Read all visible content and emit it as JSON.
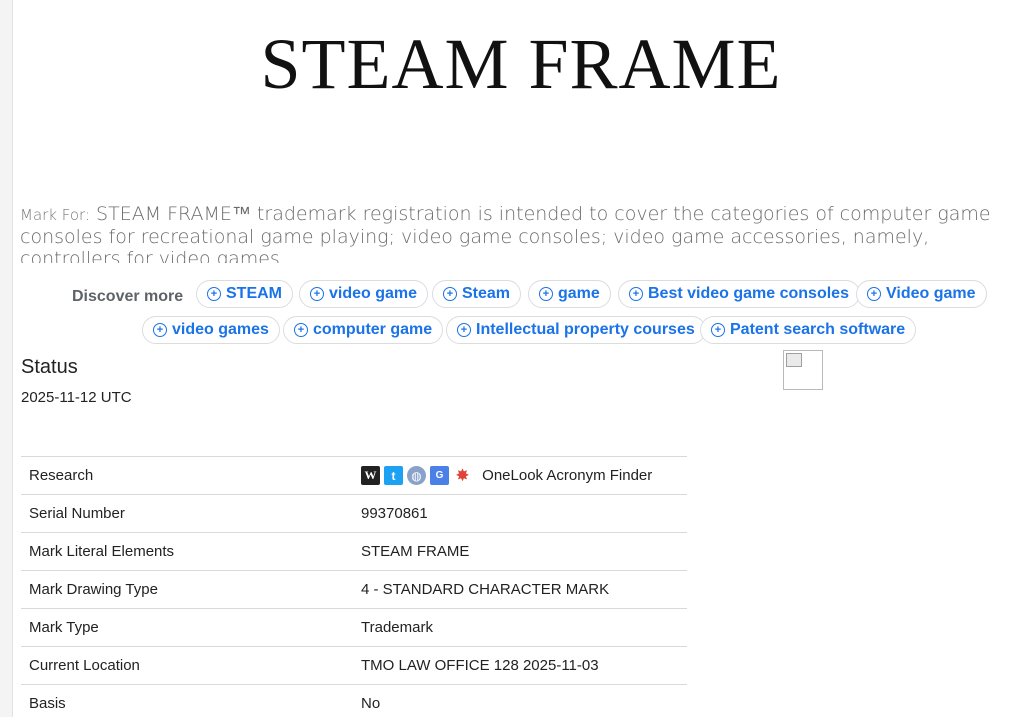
{
  "mark": {
    "title": "STEAM FRAME",
    "mark_for_label": "Mark For:",
    "mark_for_text": "STEAM FRAME™ trademark registration is intended to cover the categories of computer game consoles for recreational game playing; video game consoles; video game accessories, namely, controllers for video games."
  },
  "discover": {
    "label": "Discover more",
    "chips": [
      "STEAM",
      "video game",
      "Steam",
      "game",
      "Best video game consoles",
      "Video game",
      "video games",
      "computer game",
      "Intellectual property courses",
      "Patent search software"
    ]
  },
  "status": {
    "title": "Status",
    "date": "2025-11-12 UTC"
  },
  "research": {
    "icons": [
      "wikipedia-icon",
      "twitter-icon",
      "web-icon",
      "translate-icon",
      "splat-icon"
    ],
    "link_text": "OneLook Acronym Finder"
  },
  "details": [
    {
      "key": "Research",
      "value": ""
    },
    {
      "key": "Serial Number",
      "value": "99370861"
    },
    {
      "key": "Mark Literal Elements",
      "value": "STEAM FRAME"
    },
    {
      "key": "Mark Drawing Type",
      "value": "4 - STANDARD CHARACTER MARK"
    },
    {
      "key": "Mark Type",
      "value": "Trademark"
    },
    {
      "key": "Current Location",
      "value": "TMO LAW OFFICE 128 2025-11-03"
    },
    {
      "key": "Basis",
      "value": "No"
    }
  ],
  "colors": {
    "chip_text": "#1a73e8",
    "chip_border": "#dadce0"
  }
}
